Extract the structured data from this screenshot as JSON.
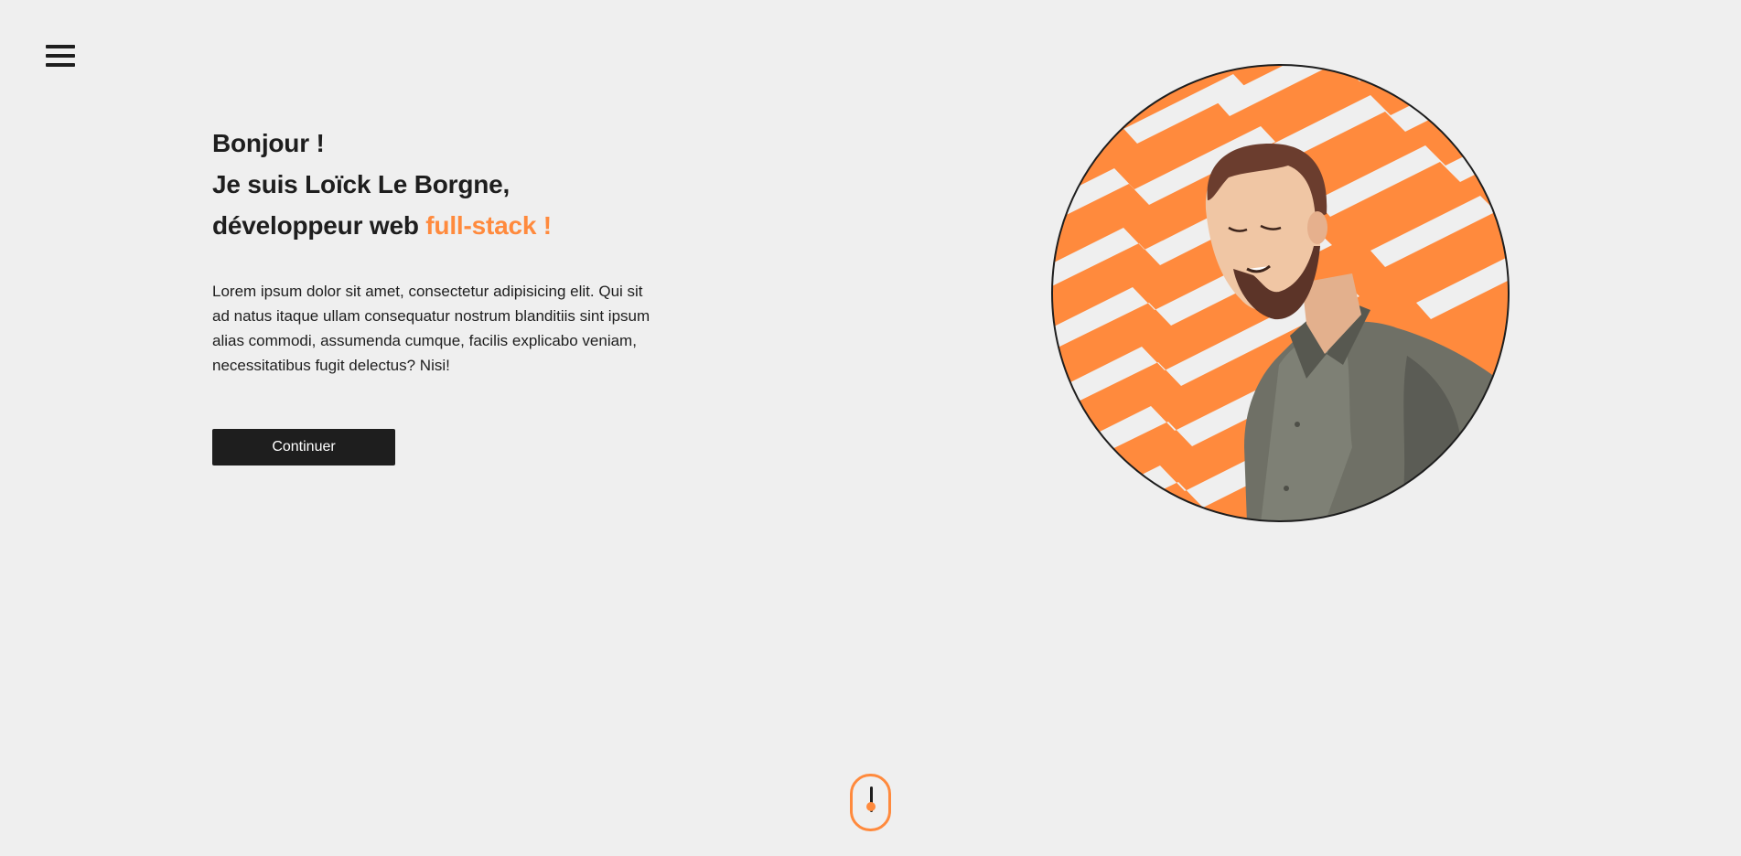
{
  "nav": {
    "menu_icon": "hamburger-menu-icon"
  },
  "hero": {
    "greeting": "Bonjour !",
    "intro": "Je suis Loïck Le Borgne,",
    "role_prefix": "développeur web ",
    "role_highlight": "full-stack !",
    "paragraph": "Lorem ipsum dolor sit amet, consectetur adipisicing elit. Qui sit ad natus itaque ullam consequatur nostrum blanditiis sint ipsum alias commodi, assumenda cumque, facilis explicabo veniam, necessitatibus fugit delectus? Nisi!",
    "continue_label": "Continuer"
  },
  "portrait": {
    "alt": "Illustrated portrait"
  },
  "scroll": {
    "icon": "mouse-scroll-icon"
  },
  "colors": {
    "accent": "#ff8a3d",
    "text": "#1e1e1e",
    "background": "#efefef",
    "shirt": "#6f7066"
  }
}
